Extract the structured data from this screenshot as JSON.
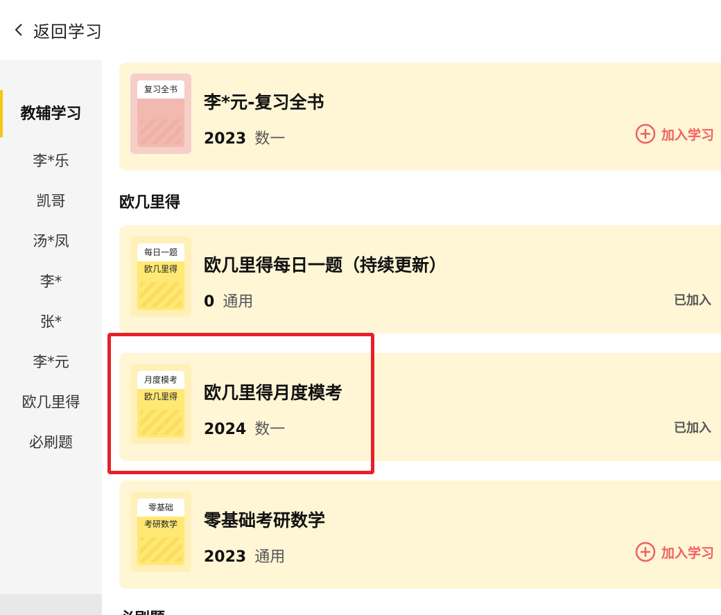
{
  "header": {
    "back_label": "返回学习"
  },
  "sidebar": {
    "active_label": "教辅学习",
    "items": [
      "李*乐",
      "凯哥",
      "汤*凤",
      "李*",
      "张*",
      "李*元",
      "欧几里得",
      "必刷题"
    ]
  },
  "sections": {
    "euclid": "欧几里得",
    "bishuati": "必刷题"
  },
  "cards": [
    {
      "cover_top": "复习全书",
      "cover_sub": "",
      "title": "李*元-复习全书",
      "year": "2023",
      "subject": "数一",
      "action": "加入学习"
    },
    {
      "cover_top": "每日一题",
      "cover_sub": "欧几里得",
      "title": "欧几里得每日一题（持续更新）",
      "year": "0",
      "subject": "通用",
      "action": "已加入"
    },
    {
      "cover_top": "月度模考",
      "cover_sub": "欧几里得",
      "title": "欧几里得月度模考",
      "year": "2024",
      "subject": "数一",
      "action": "已加入"
    },
    {
      "cover_top": "零基础",
      "cover_sub": "考研数学",
      "title": "零基础考研数学",
      "year": "2023",
      "subject": "通用",
      "action": "加入学习"
    }
  ],
  "colors": {
    "accent": "#f5c518",
    "card_bg": "#fff6d6",
    "join": "#f06060",
    "highlight": "#e6202a"
  },
  "icons": {
    "back": "chevron-left-icon",
    "add": "plus-circle-icon"
  }
}
